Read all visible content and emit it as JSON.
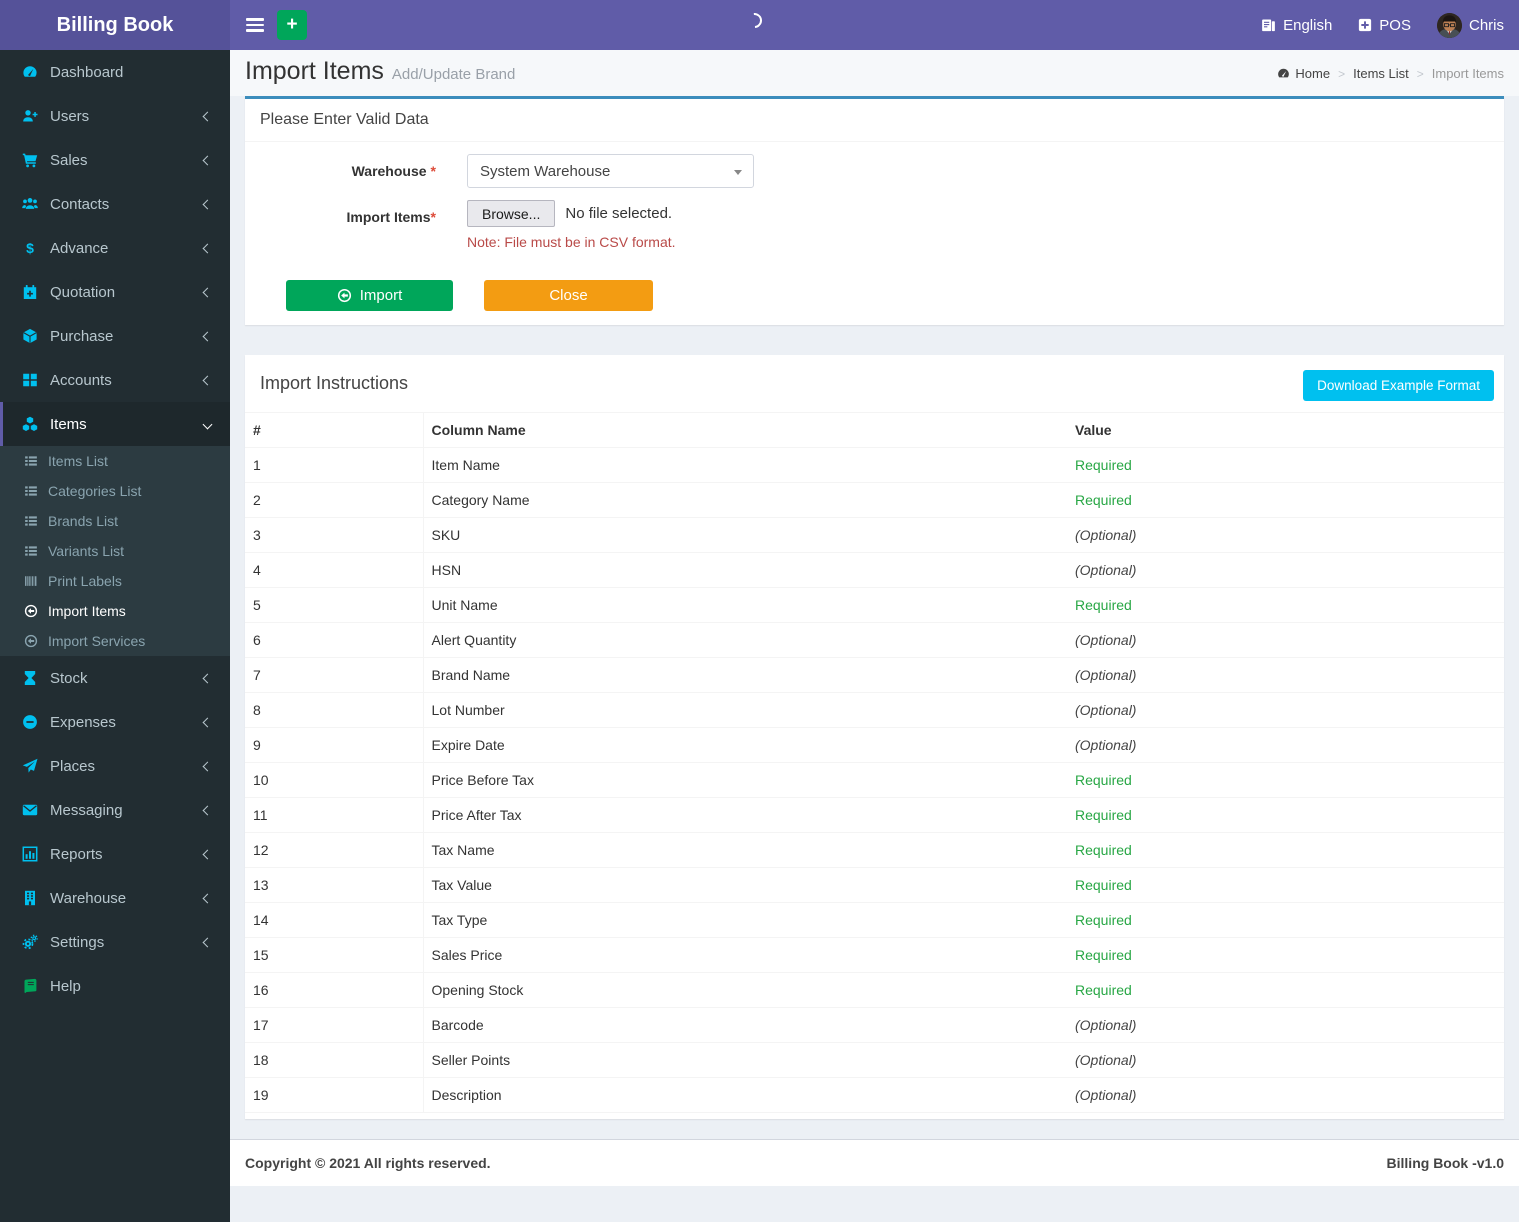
{
  "colors": {
    "navbar": "#605ca8",
    "logo_bg": "#555299",
    "sidebar_bg": "#222d32",
    "submenu_bg": "#2c3b41",
    "sidebar_icon": "#00c0ef",
    "panel_top_border": "#3c8dbc",
    "import_button": "#00a65a",
    "close_button": "#f39c12",
    "download_button": "#00c0ef",
    "required_text": "#28a745",
    "note_red": "#b94a48",
    "help_icon_green": "#00a65a"
  },
  "navbar": {
    "brand": "Billing Book",
    "quick_add_label": "+",
    "language_label": "English",
    "pos_label": "POS",
    "user_name": "Chris"
  },
  "sidebar": {
    "items": [
      {
        "label": "Dashboard",
        "icon": "gauge"
      },
      {
        "label": "Users",
        "icon": "user-plus",
        "chevron": "left"
      },
      {
        "label": "Sales",
        "icon": "cart",
        "chevron": "left"
      },
      {
        "label": "Contacts",
        "icon": "users",
        "chevron": "left"
      },
      {
        "label": "Advance",
        "icon": "dollar",
        "chevron": "left"
      },
      {
        "label": "Quotation",
        "icon": "calendar-plus",
        "chevron": "left"
      },
      {
        "label": "Purchase",
        "icon": "cube",
        "chevron": "left"
      },
      {
        "label": "Accounts",
        "icon": "th-large",
        "chevron": "left"
      },
      {
        "label": "Items",
        "icon": "cubes",
        "chevron": "down",
        "active": true,
        "children": [
          {
            "label": "Items List",
            "icon": "list"
          },
          {
            "label": "Categories List",
            "icon": "list"
          },
          {
            "label": "Brands List",
            "icon": "list"
          },
          {
            "label": "Variants List",
            "icon": "list"
          },
          {
            "label": "Print Labels",
            "icon": "barcode"
          },
          {
            "label": "Import Items",
            "icon": "arrow-circle",
            "active": true
          },
          {
            "label": "Import Services",
            "icon": "arrow-circle"
          }
        ]
      },
      {
        "label": "Stock",
        "icon": "hourglass",
        "chevron": "left"
      },
      {
        "label": "Expenses",
        "icon": "minus-circle",
        "chevron": "left"
      },
      {
        "label": "Places",
        "icon": "paper-plane",
        "chevron": "left"
      },
      {
        "label": "Messaging",
        "icon": "envelope",
        "chevron": "left"
      },
      {
        "label": "Reports",
        "icon": "bar-chart",
        "chevron": "left"
      },
      {
        "label": "Warehouse",
        "icon": "building",
        "chevron": "left"
      },
      {
        "label": "Settings",
        "icon": "gears",
        "chevron": "left"
      },
      {
        "label": "Help",
        "icon": "book",
        "icon_color": "#00a65a"
      }
    ]
  },
  "header": {
    "title": "Import Items",
    "subtitle": "Add/Update Brand",
    "breadcrumb": [
      {
        "label": "Home",
        "icon": "gauge"
      },
      {
        "label": "Items List"
      },
      {
        "label": "Import Items"
      }
    ]
  },
  "form": {
    "panel_title": "Please Enter Valid Data",
    "warehouse_label": "Warehouse",
    "required_mark": "*",
    "warehouse_value": "System Warehouse",
    "import_label": "Import Items",
    "browse_label": "Browse...",
    "file_status": "No file selected.",
    "note": "Note: File must be in CSV format.",
    "import_button": "Import",
    "close_button": "Close"
  },
  "instructions": {
    "title": "Import Instructions",
    "download_button": "Download Example Format",
    "table": {
      "headers": [
        "#",
        "Column Name",
        "Value"
      ],
      "rows": [
        [
          "1",
          "Item Name",
          "Required"
        ],
        [
          "2",
          "Category Name",
          "Required"
        ],
        [
          "3",
          "SKU",
          "(Optional)"
        ],
        [
          "4",
          "HSN",
          "(Optional)"
        ],
        [
          "5",
          "Unit Name",
          "Required"
        ],
        [
          "6",
          "Alert Quantity",
          "(Optional)"
        ],
        [
          "7",
          "Brand Name",
          "(Optional)"
        ],
        [
          "8",
          "Lot Number",
          "(Optional)"
        ],
        [
          "9",
          "Expire Date",
          "(Optional)"
        ],
        [
          "10",
          "Price Before Tax",
          "Required"
        ],
        [
          "11",
          "Price After Tax",
          "Required"
        ],
        [
          "12",
          "Tax Name",
          "Required"
        ],
        [
          "13",
          "Tax Value",
          "Required"
        ],
        [
          "14",
          "Tax Type",
          "Required"
        ],
        [
          "15",
          "Sales Price",
          "Required"
        ],
        [
          "16",
          "Opening Stock",
          "Required"
        ],
        [
          "17",
          "Barcode",
          "(Optional)"
        ],
        [
          "18",
          "Seller Points",
          "(Optional)"
        ],
        [
          "19",
          "Description",
          "(Optional)"
        ]
      ]
    }
  },
  "footer": {
    "left": "Copyright © 2021 All rights reserved.",
    "right": "Billing Book -v1.0"
  }
}
